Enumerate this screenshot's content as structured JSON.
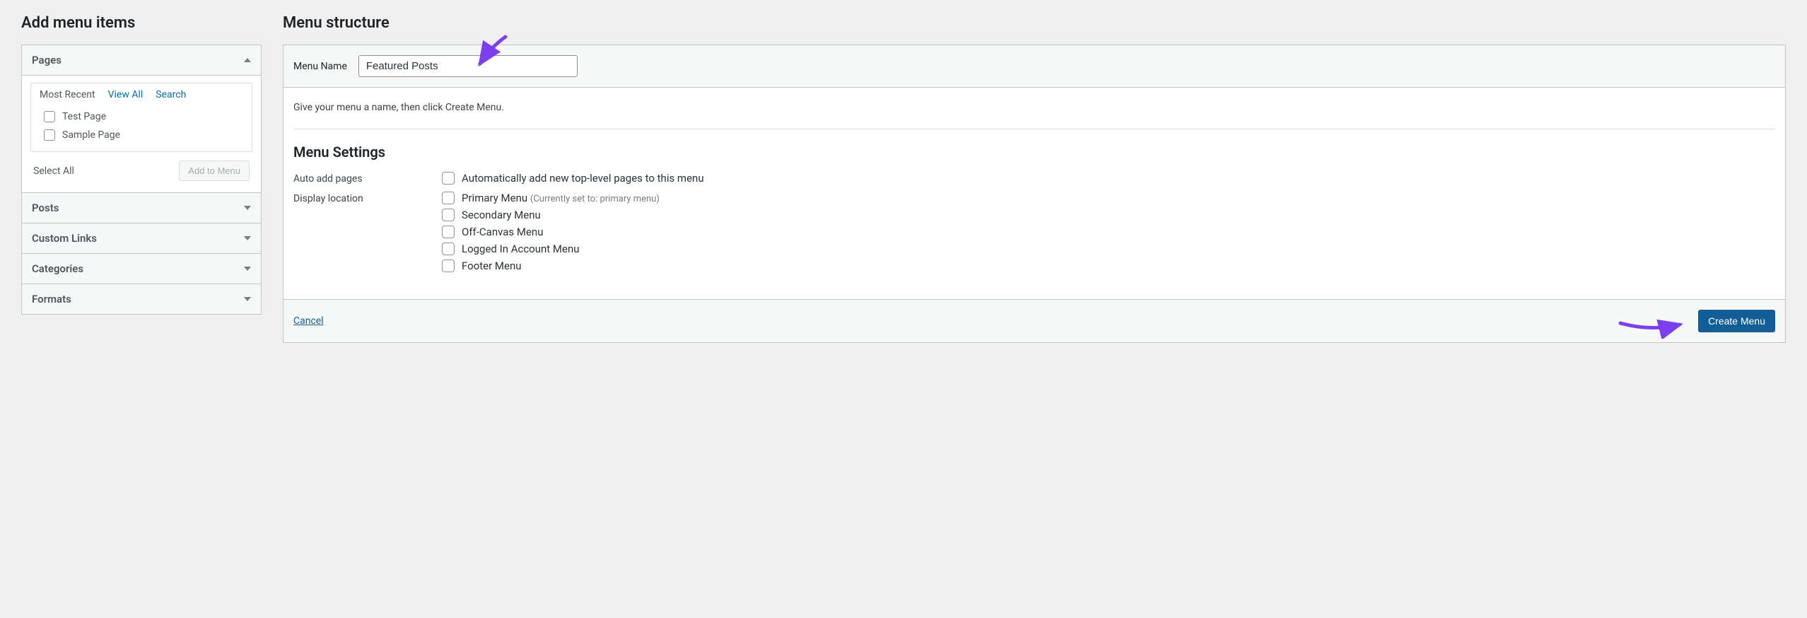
{
  "sidebar": {
    "title": "Add menu items",
    "pages": {
      "label": "Pages",
      "tabs": {
        "recent": "Most Recent",
        "view_all": "View All",
        "search": "Search"
      },
      "items": [
        "Test Page",
        "Sample Page"
      ],
      "select_all": "Select All",
      "add_btn": "Add to Menu"
    },
    "sections": {
      "posts": "Posts",
      "custom_links": "Custom Links",
      "categories": "Categories",
      "formats": "Formats"
    }
  },
  "main": {
    "title": "Menu structure",
    "menu_name_label": "Menu Name",
    "menu_name_value": "Featured Posts",
    "help": "Give your menu a name, then click Create Menu.",
    "settings_title": "Menu Settings",
    "auto_add": {
      "label": "Auto add pages",
      "option": "Automatically add new top-level pages to this menu"
    },
    "display_location": {
      "label": "Display location",
      "options": [
        {
          "label": "Primary Menu",
          "hint": "(Currently set to: primary menu)"
        },
        {
          "label": "Secondary Menu",
          "hint": ""
        },
        {
          "label": "Off-Canvas Menu",
          "hint": ""
        },
        {
          "label": "Logged In Account Menu",
          "hint": ""
        },
        {
          "label": "Footer Menu",
          "hint": ""
        }
      ]
    },
    "cancel": "Cancel",
    "create": "Create Menu"
  }
}
